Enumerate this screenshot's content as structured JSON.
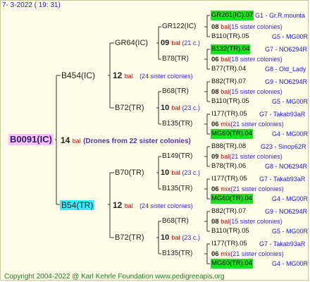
{
  "date": "7-  3-2022 ( 19: 31)",
  "root": {
    "id": "B0091(IC)",
    "num": "14",
    "bal": "bal",
    "drones": "(Drones from 22 sister colonies)"
  },
  "g1": [
    {
      "id": "B454(IC)",
      "num": "12",
      "bal": "bal",
      "sis": "(24 sister colonies)"
    },
    {
      "id": "B54(TR)",
      "num": "12",
      "bal": "bal",
      "sis": "(24 sister colonies)"
    }
  ],
  "g2": [
    {
      "id": "GR64(IC)",
      "num": "09",
      "bal": "bal",
      "sis": "(21 c.)"
    },
    {
      "id": "B72(TR)",
      "num": "10",
      "bal": "bal",
      "sis": "(23 c.)"
    },
    {
      "id": "B70(TR)",
      "num": "10",
      "bal": "bal",
      "sis": "(23 c.)"
    },
    {
      "id": "B72(TR)",
      "num": "10",
      "bal": "bal",
      "sis": "(23 c.)"
    }
  ],
  "g3": [
    {
      "id": "GR122(IC)"
    },
    {
      "id": "B78(TR)"
    },
    {
      "id": "B68(TR)"
    },
    {
      "id": "B135(TR)"
    },
    {
      "id": "B149(TR)"
    },
    {
      "id": "B135(TR)"
    },
    {
      "id": "B68(TR)"
    },
    {
      "id": "B135(TR)"
    }
  ],
  "g4": [
    {
      "top": "GR201(IC).07",
      "num": "08",
      "bal": "bal",
      "sis": "(15 sister colonies)",
      "bot": "B110(TR).05",
      "rt": "G1 - Gr.R.mounta",
      "rb": "G5 - MG00R"
    },
    {
      "top": "B132(TR).04",
      "num": "06",
      "bal": "bal",
      "sis": "(18 sister colonies)",
      "bot": "B77(TR).04",
      "rt": "G7 - NO6294R",
      "rb": "G8 - Old_Lady"
    },
    {
      "top": "B82(TR).07",
      "num": "08",
      "bal": "bal",
      "sis": "(15 sister colonies)",
      "bot": "B110(TR).05",
      "rt": "G9 - NO6294R",
      "rb": "G5 - MG00R"
    },
    {
      "top": "I177(TR).05",
      "num": "06",
      "bal": "mix",
      "sis": "(21 sister colonies)",
      "bot": "MG60(TR).04",
      "rt": "G7 - Takab93aR",
      "rb": "G4 - MG00R"
    },
    {
      "top": "B88(TR).08",
      "num": "09",
      "bal": "bal",
      "sis": "(21 sister colonies)",
      "bot": "B78(TR).06",
      "rt": "G23 - Sinop62R",
      "rb": "G8 - NO6294R"
    },
    {
      "top": "I177(TR).05",
      "num": "06",
      "bal": "mix",
      "sis": "(21 sister colonies)",
      "bot": "MG60(TR).04",
      "rt": "G7 - Takab93aR",
      "rb": "G4 - MG00R"
    },
    {
      "top": "B82(TR).07",
      "num": "08",
      "bal": "bal",
      "sis": "(15 sister colonies)",
      "bot": "B110(TR).05",
      "rt": "G9 - NO6294R",
      "rb": "G5 - MG00R"
    },
    {
      "top": "I177(TR).05",
      "num": "06",
      "bal": "mix",
      "sis": "(21 sister colonies)",
      "bot": "MG60(TR).04",
      "rt": "G7 - Takab93aR",
      "rb": "G4 - MG00R"
    }
  ],
  "copyright": "Copyright 2004-2022 @ Karl Kehrle Foundation    www.pedigreeapis.org"
}
